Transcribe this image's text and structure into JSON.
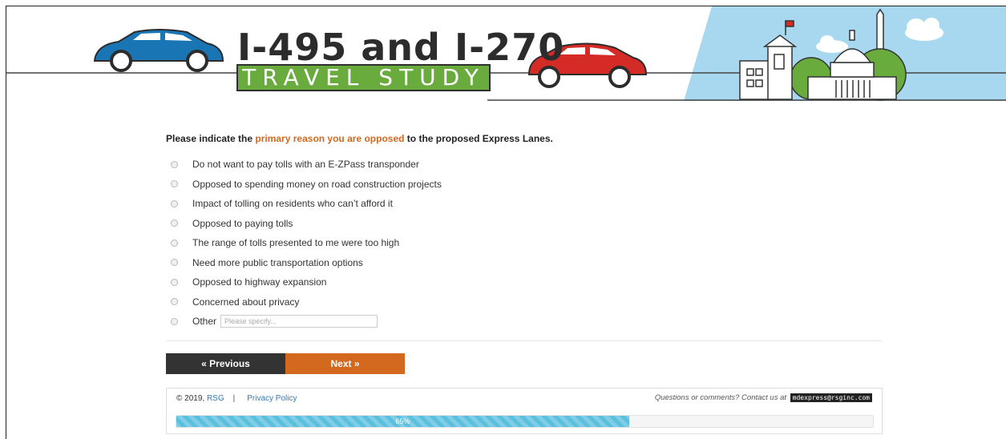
{
  "header": {
    "title": "I-495 and I-270",
    "subtitle": "TRAVEL STUDY"
  },
  "question": {
    "prefix": "Please indicate the ",
    "highlight": "primary reason you are opposed",
    "suffix": " to the proposed Express Lanes.",
    "options": [
      "Do not want to pay tolls with an E-ZPass transponder",
      "Opposed to spending money on road construction projects",
      "Impact of tolling on residents who can’t afford it",
      "Opposed to paying tolls",
      "The range of tolls presented to me were too high",
      "Need more public transportation options",
      "Opposed to highway expansion",
      "Concerned about privacy"
    ],
    "other_label": "Other",
    "other_placeholder": "Please specify..."
  },
  "nav": {
    "previous_label": "« Previous",
    "next_label": "Next »"
  },
  "footer": {
    "copyright": "© 2019, ",
    "company_link": "RSG",
    "separator": "|",
    "privacy_link": "Privacy Policy",
    "contact_text": "Questions or comments? Contact us at ",
    "contact_email": "mdexpress@rsginc.com",
    "progress_label": "65%",
    "progress_value": 0.65
  },
  "colors": {
    "accent_orange": "#d3691f",
    "dark_button": "#333333",
    "green_banner": "#6aab3e",
    "sky_blue": "#a8d8ef",
    "car_blue": "#1a75b5",
    "car_red": "#d42b27",
    "progress_blue": "#5bc0de",
    "link_blue": "#337ab7"
  }
}
